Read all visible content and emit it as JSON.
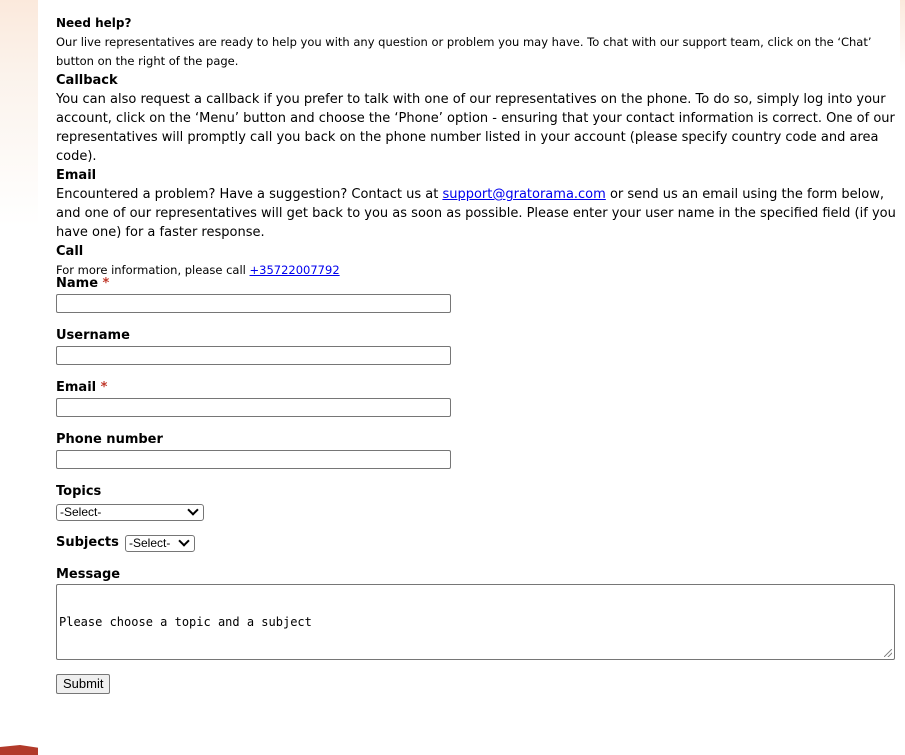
{
  "help": {
    "need_help_title": "Need help?",
    "need_help_text": "Our live representatives are ready to help you with any question or problem you may have. To chat with our support team, click on the ‘Chat’ button on the right of the page.",
    "callback_title": "Callback",
    "callback_text": "You can also request a callback if you prefer to talk with one of our representatives on the phone. To do so, simply log into your account, click on the ‘Menu’ button and choose the ‘Phone’ option - ensuring that your contact information is correct. One of our representatives will promptly call you back on the phone number listed in your account (please specify country code and area code).",
    "email_title": "Email",
    "email_text_before": "Encountered a problem? Have a suggestion? Contact us at ",
    "email_link": "support@gratorama.com",
    "email_text_after": " or send us an email using the form below, and one of our representatives will get back to you as soon as possible. Please enter your user name in the specified field (if you have one) for a faster response.",
    "call_title": "Call",
    "call_text": "For more information, please call ",
    "call_link": "+35722007792"
  },
  "form": {
    "name_label": "Name",
    "username_label": "Username",
    "email_label": "Email",
    "phone_label": "Phone number",
    "required_mark": "*",
    "topics_label": "Topics",
    "topics_value": "-Select-",
    "subjects_label": "Subjects",
    "subjects_value": "-Select-",
    "message_label": "Message",
    "message_value": "Please choose a topic and a subject",
    "submit_label": "Submit"
  },
  "colors": {
    "link": "#0000ee",
    "required": "#c0392b",
    "background_tint": "#fbe9dc"
  }
}
